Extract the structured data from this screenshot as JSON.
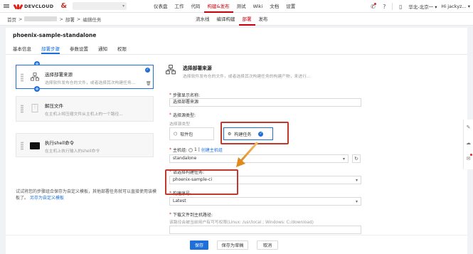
{
  "brand": {
    "name": "DEVCLOUD",
    "amp": "&"
  },
  "topnav": [
    {
      "label": "仪表盘",
      "active": false
    },
    {
      "label": "工作",
      "active": false
    },
    {
      "label": "代码",
      "active": false
    },
    {
      "label": "构建&发布",
      "active": true
    },
    {
      "label": "测试",
      "active": false
    },
    {
      "label": "Wiki",
      "active": false
    },
    {
      "label": "文档",
      "active": false
    },
    {
      "label": "设置",
      "active": false
    }
  ],
  "topright": {
    "region": "华北-北京一 ▾",
    "user": "Hi jackyz... ▾"
  },
  "breadcrumb": {
    "home": "首页",
    "sep": ">",
    "deploy": "部署",
    "edit": "编辑任务"
  },
  "stepnav": [
    {
      "label": "流水线",
      "active": false
    },
    {
      "label": "编译构建",
      "active": false
    },
    {
      "label": "部署",
      "active": true
    },
    {
      "label": "发布",
      "active": false
    }
  ],
  "page": {
    "title": "phoenix-sample-standalone"
  },
  "tabs": [
    {
      "label": "基本信息",
      "active": false
    },
    {
      "label": "部署步骤",
      "active": true
    },
    {
      "label": "参数设置",
      "active": false
    },
    {
      "label": "通知",
      "active": false
    },
    {
      "label": "权限",
      "active": false
    }
  ],
  "steps": [
    {
      "title": "选择部署来源",
      "desc": "选择软件发布仓的文件，或者选择其次构建任务..."
    },
    {
      "title": "解压文件",
      "desc": "在主机上将压缩文件从主机上的一个路径..."
    },
    {
      "title": "执行shell命令",
      "desc": "在主机上执行输入的shell命令"
    }
  ],
  "tip": {
    "text": "试试将您的步骤组合保存为自定义模板，其他部署任务就可以直接使用该模板了。",
    "link": "另存为自定义模板"
  },
  "detail": {
    "title": "选择部署来源",
    "desc": "选择软件发布仓的文件，或者选择其次构建任务的构建产物，来进行...",
    "step_name_label": "步骤显示名称:",
    "step_name_value": "选择部署来源",
    "source_type_label": "选择源类型:",
    "source_type_sub": "选择源类型",
    "source_pkg": "软件包",
    "source_build": "构建任务",
    "host_label": "主机组:",
    "host_help": "?",
    "host_count": "1",
    "host_create": "创建主机组",
    "host_value": "standalone",
    "build_task_label": "请选择构建任务:",
    "build_task_value": "phoenix-sample-ci",
    "build_no_label": "构建序号:",
    "build_no_value": "Latest",
    "download_label": "下载文件到主机路径:",
    "download_hint": "该路径会被当前用户有可写权限(Linux: /usr/local ; Windows: C:/download)"
  },
  "footer": {
    "save": "保存",
    "save_draft": "保存为草稿",
    "cancel": "取消"
  },
  "colors": {
    "accent": "#1e6fd9",
    "brand": "#c7000b",
    "highlight": "#c0392b"
  }
}
